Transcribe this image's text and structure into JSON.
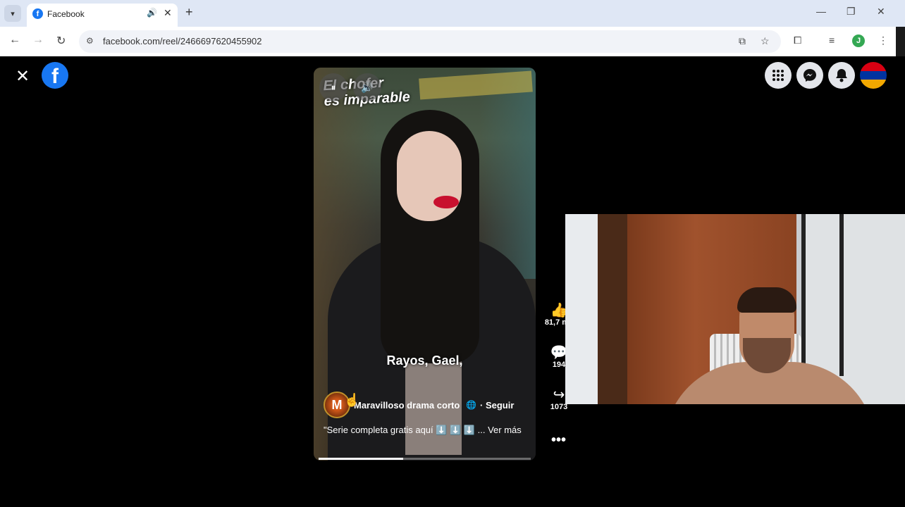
{
  "browser": {
    "tab_title": "Facebook",
    "tab_favicon": "f",
    "url": "facebook.com/reel/2466697620455902",
    "profile_initial": "J"
  },
  "page": {
    "reel": {
      "title_line1": "El chofer",
      "title_line2": "es imparable",
      "subtitle": "Rayos, Gael,",
      "author": "Maravilloso drama corto",
      "author_avatar_letter": "M",
      "follow_label": "· Seguir",
      "caption": "\"Serie completa gratis aquí ⬇️ ⬇️ ⬇️ ... Ver más",
      "progress_fraction": 0.4
    },
    "actions": {
      "likes": "81,7 mil",
      "comments": "194",
      "shares": "1073"
    }
  },
  "colors": {
    "facebook_blue": "#1877f2",
    "page_bg": "#000000",
    "chrome_tabbar": "#dfe7f5"
  }
}
